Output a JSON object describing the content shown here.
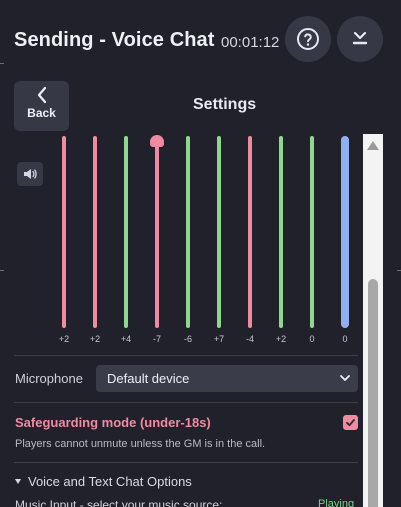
{
  "header": {
    "title": "Sending - Voice Chat",
    "timer": "00:01:12",
    "help_icon": "question-circle-icon",
    "download_icon": "download-icon"
  },
  "nav": {
    "back_label": "Back",
    "settings_title": "Settings"
  },
  "equalizer": {
    "speaker_icon": "speaker-icon",
    "labels": [
      "+2",
      "+2",
      "+4",
      "-7",
      "-6",
      "+7",
      "-4",
      "+2",
      "0",
      "0"
    ],
    "colors": {
      "pink": "#f08aa0",
      "green": "#8fd78f",
      "blue": "#8fb0f0"
    }
  },
  "microphone": {
    "label": "Microphone",
    "selected": "Default device"
  },
  "safeguarding": {
    "title": "Safeguarding mode (under-18s)",
    "description": "Players cannot unmute unless the GM is in the call.",
    "checked": true
  },
  "voice_text_section": {
    "label": "Voice and Text Chat Options"
  },
  "music": {
    "label": "Music Input - select your music source:",
    "status": "Playing"
  }
}
